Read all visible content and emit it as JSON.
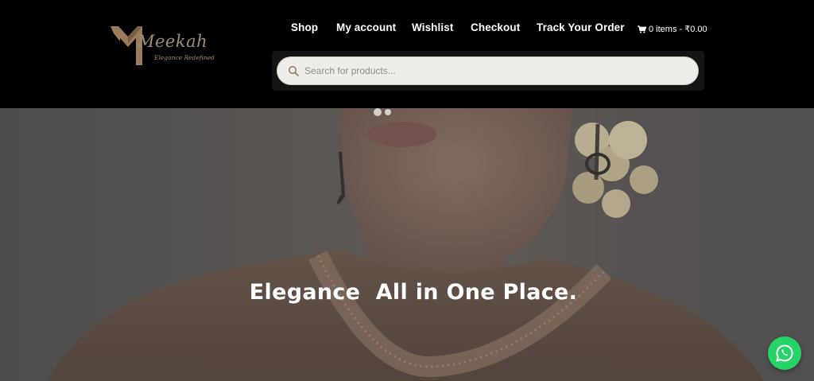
{
  "brand": {
    "name": "Meekah",
    "tagline": "Elegance Redefined",
    "accent_color": "#9b8f7a"
  },
  "nav": {
    "items": [
      {
        "label": "Shop"
      },
      {
        "label": "My account"
      },
      {
        "label": "Wishlist"
      },
      {
        "label": "Checkout"
      },
      {
        "label": "Track Your Order"
      }
    ]
  },
  "cart": {
    "icon": "cart-icon",
    "summary": "0 items - ₹0.00"
  },
  "search": {
    "icon": "search-icon",
    "placeholder": "Search for products...",
    "value": ""
  },
  "hero": {
    "title": "Elegance  All in One Place."
  },
  "chat": {
    "icon": "whatsapp-icon",
    "color": "#25d366"
  }
}
